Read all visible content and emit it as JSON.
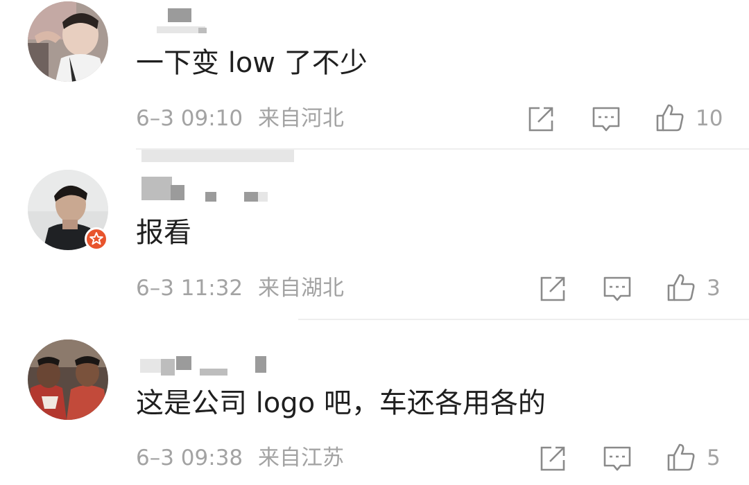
{
  "comments": [
    {
      "text": "一下变 low 了不少",
      "date": "6–3 09:10",
      "location": "来自河北",
      "likes": "10",
      "verified": false
    },
    {
      "text": "报看",
      "date": "6–3 11:32",
      "location": "来自湖北",
      "likes": "3",
      "verified": true
    },
    {
      "text": "这是公司 logo 吧，车还各用各的",
      "date": "6–3 09:38",
      "location": "来自江苏",
      "likes": "5",
      "verified": false
    }
  ],
  "icons": {
    "share": "share-icon",
    "comment": "comment-icon",
    "like": "thumbs-up-icon",
    "badge": "verified-badge-icon"
  },
  "colors": {
    "text": "#1f1f1f",
    "meta": "#a3a3a3",
    "icon": "#8a8a8a",
    "badge": "#e8542d",
    "divider": "#eeeeee"
  }
}
